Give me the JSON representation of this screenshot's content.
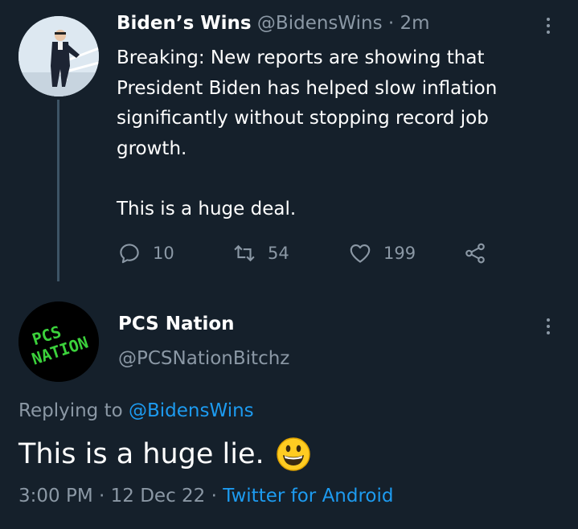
{
  "tweet1": {
    "display_name": "Biden’s Wins",
    "handle": "@BidensWins",
    "separator": "·",
    "time": "2m",
    "text_lines": [
      "Breaking: New reports are showing that",
      "President Biden has helped slow inflation",
      "significantly without stopping record job",
      "growth."
    ],
    "text_para2": "This is a huge deal.",
    "actions": {
      "replies": "10",
      "retweets": "54",
      "likes": "199"
    }
  },
  "tweet2": {
    "display_name": "PCS Nation",
    "handle": "@PCSNationBitchz",
    "avatar_text_line1": "PCS",
    "avatar_text_line2": "NATION",
    "replying_prefix": "Replying to",
    "replying_handle": "@BidensWins",
    "text": "This is a huge lie.",
    "emoji": "grinning-face",
    "time": "3:00 PM",
    "separator": "·",
    "date": "12 Dec 22",
    "separator2": "·",
    "source": "Twitter for Android"
  },
  "colors": {
    "background": "#15202b",
    "muted": "#8b98a5",
    "link": "#1d9bf0",
    "thread_line": "#3d5466",
    "avatar_text": "#3bd13b"
  }
}
